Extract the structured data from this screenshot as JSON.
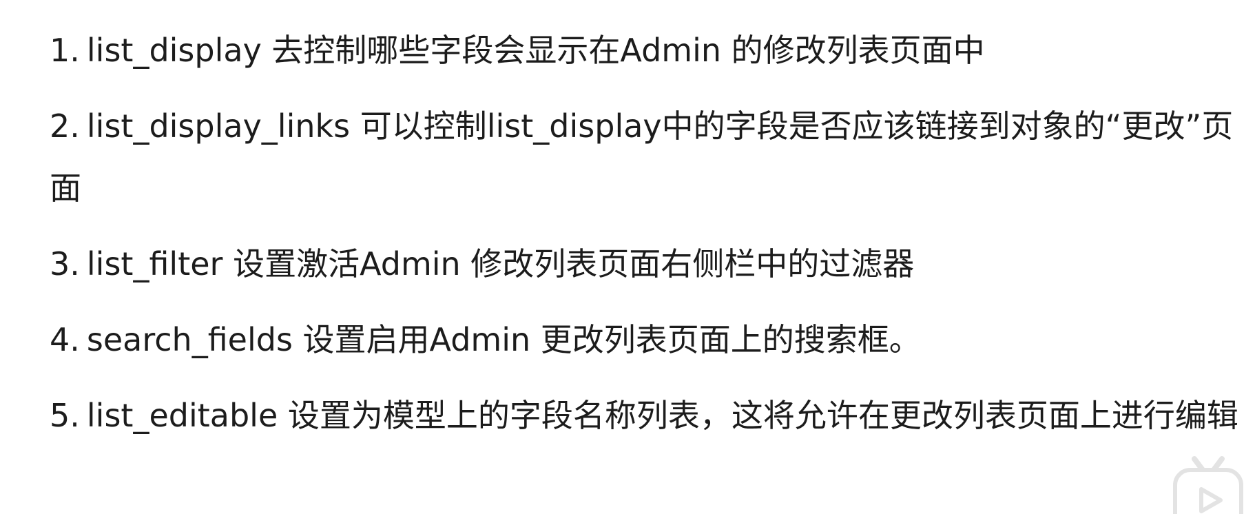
{
  "items": [
    {
      "num": "1.",
      "text": "list_display 去控制哪些字段会显示在Admin 的修改列表页面中"
    },
    {
      "num": "2.",
      "text": "list_display_links 可以控制list_display中的字段是否应该链接到对象的“更改”页面"
    },
    {
      "num": "3.",
      "text": "list_filter 设置激活Admin 修改列表页面右侧栏中的过滤器"
    },
    {
      "num": "4.",
      "text": "search_fields 设置启用Admin 更改列表页面上的搜索框。"
    },
    {
      "num": "5.",
      "text": "list_editable 设置为模型上的字段名称列表，这将允许在更改列表页面上进行编辑"
    }
  ],
  "watermark": {
    "icon": "bilibili-tv-icon"
  }
}
